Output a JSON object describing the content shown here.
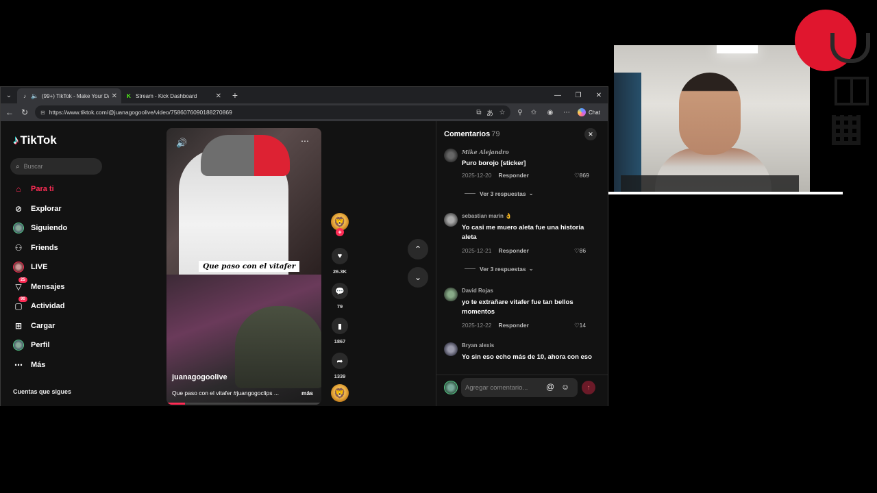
{
  "browser": {
    "tabs": [
      {
        "title": "(99+) TikTok - Make Your Day",
        "favicon": "tiktok-icon",
        "active": true
      },
      {
        "title": "Stream - Kick Dashboard",
        "favicon": "kick-icon",
        "active": false
      }
    ],
    "url": "https://www.tiktok.com/@juanagogoolive/video/7586076090188270869",
    "chat_label": "Chat"
  },
  "tiktok": {
    "logo": "TikTok",
    "search_placeholder": "Buscar",
    "nav": [
      {
        "label": "Para ti",
        "icon": "home-icon",
        "active": true
      },
      {
        "label": "Explorar",
        "icon": "compass-icon"
      },
      {
        "label": "Siguiendo",
        "icon": "following-avatar"
      },
      {
        "label": "Friends",
        "icon": "friends-icon"
      },
      {
        "label": "LIVE",
        "icon": "live-avatar"
      },
      {
        "label": "Mensajes",
        "icon": "messages-icon",
        "badge": "25"
      },
      {
        "label": "Actividad",
        "icon": "activity-icon",
        "badge": "90"
      },
      {
        "label": "Cargar",
        "icon": "upload-icon"
      },
      {
        "label": "Perfil",
        "icon": "profile-avatar"
      },
      {
        "label": "Más",
        "icon": "more-icon"
      }
    ],
    "following_title": "Cuentas que sigues",
    "video": {
      "caption_overlay": "Que paso con el vitafer",
      "author": "juanagogoolive",
      "description": "Que paso con el vitafer #juangogoclips ...",
      "more": "más",
      "progress": 0.12
    },
    "actions": {
      "likes": "26.3K",
      "comments": "79",
      "saves": "1867",
      "shares": "1339"
    },
    "comments": {
      "title": "Comentarios",
      "count": "79",
      "input_placeholder": "Agregar comentario...",
      "items": [
        {
          "user": "Mike Alejandro",
          "text": "Puro borojo [sticker]",
          "date": "2025-12-20",
          "reply": "Responder",
          "likes": "869",
          "replies": "Ver 3 respuestas"
        },
        {
          "user": "sebastian marin 👌",
          "text": "Yo casi me muero aleta fue una historia aleta",
          "date": "2025-12-21",
          "reply": "Responder",
          "likes": "86",
          "replies": "Ver 3 respuestas"
        },
        {
          "user": "David Rojas",
          "text": "yo te extrañare vitafer fue tan bellos momentos",
          "date": "2025-12-22",
          "reply": "Responder",
          "likes": "14"
        },
        {
          "user": "Bryan alexis",
          "text": "Yo sin eso echo más de 10, ahora con eso"
        }
      ]
    }
  },
  "colors": {
    "accent": "#fe2c55",
    "background": "#121212",
    "brand_red": "#e0162e"
  }
}
